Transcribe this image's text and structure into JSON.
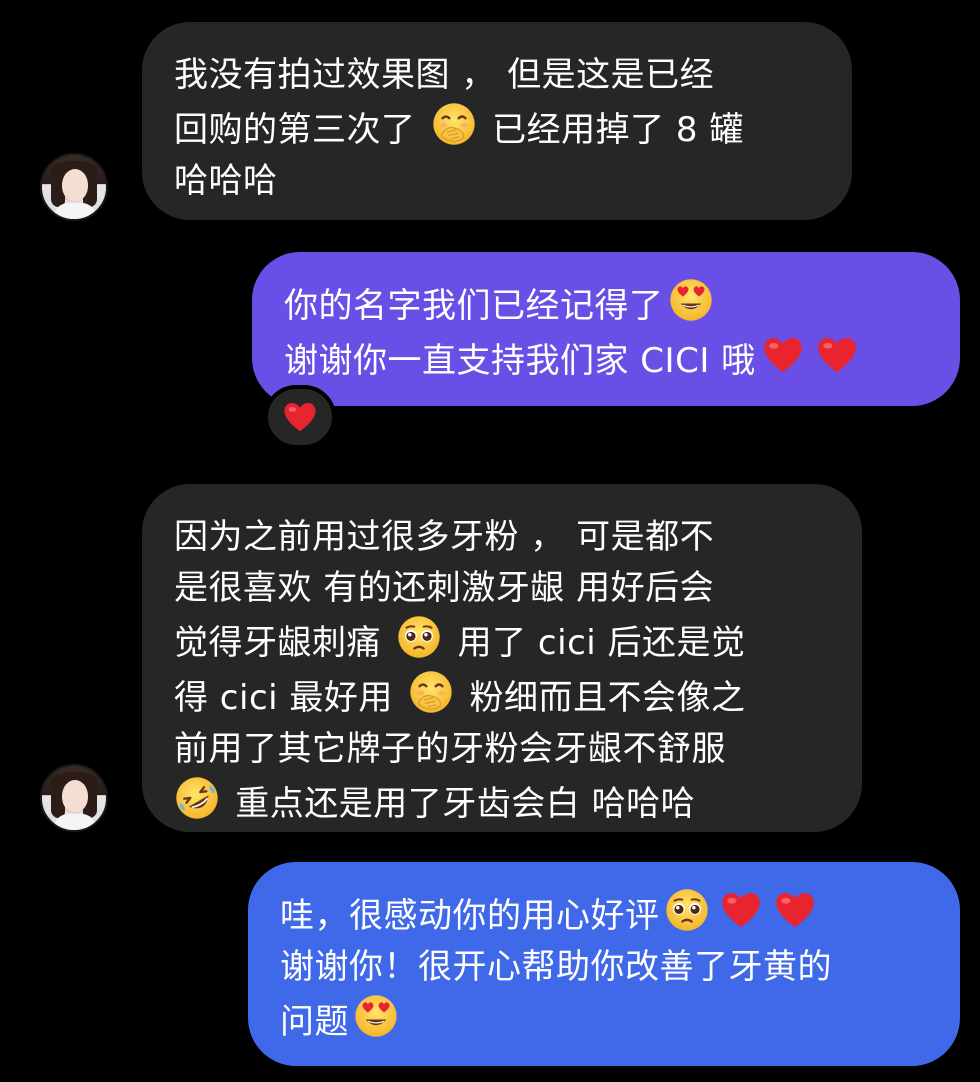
{
  "messages": [
    {
      "direction": "incoming",
      "lines": [
        "我没有拍过效果图 ， 但是这是已经",
        "回购的第三次了 ",
        "哈哈哈"
      ],
      "line2_suffix": " 已经用掉了 8 罐",
      "emoji": [
        "hand-over-mouth-emoji"
      ]
    },
    {
      "direction": "outgoing",
      "line1": "你的名字我们已经记得了",
      "line2": "谢谢你一直支持我们家 CICI 哦",
      "emoji": [
        "heart-eyes-emoji",
        "red-heart-emoji",
        "red-heart-emoji"
      ],
      "reaction": "red-heart-emoji",
      "color": "#6A4FE6"
    },
    {
      "direction": "incoming",
      "lines": [
        "因为之前用过很多牙粉 ， 可是都不",
        "是很喜欢 有的还刺激牙龈 用好后会",
        "觉得牙龈刺痛 ",
        "得 cici 最好用 ",
        "前用了其它牌子的牙粉会牙龈不舒服",
        " 重点还是用了牙齿会白 哈哈哈"
      ],
      "line3_suffix": " 用了 cici 后还是觉",
      "line4_suffix": " 粉细而且不会像之",
      "emoji": [
        "pleading-face-emoji",
        "hand-over-mouth-emoji",
        "rolling-on-floor-laughing-emoji"
      ]
    },
    {
      "direction": "outgoing",
      "line1": "哇，很感动你的用心好评",
      "line2": "谢谢你！很开心帮助你改善了牙黄的",
      "line3": "问题",
      "emoji": [
        "pleading-face-emoji",
        "red-heart-emoji",
        "red-heart-emoji",
        "heart-eyes-emoji"
      ],
      "color": "#3F69E8"
    }
  ],
  "colors": {
    "background": "#000000",
    "incoming_bubble": "#262626",
    "outgoing_top": "#6A4FE6",
    "outgoing_bottom": "#3F69E8",
    "heart": "#E8242F"
  }
}
